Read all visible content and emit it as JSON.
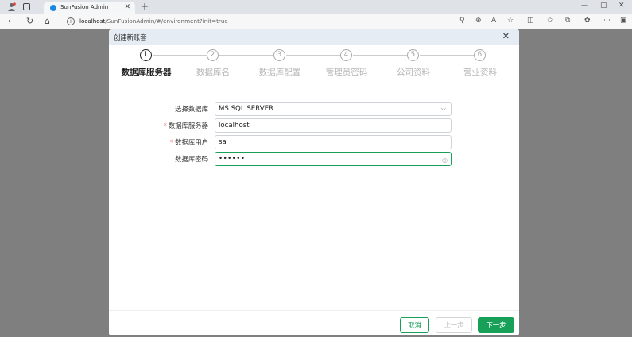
{
  "browser": {
    "tab_title": "SunFusion Admin",
    "url_host": "localhost",
    "url_rest": "/SunFusionAdmin/#/environment?init=true"
  },
  "dialog": {
    "title": "创建新账套",
    "steps": [
      {
        "num": "1",
        "label": "数据库服务器",
        "active": true
      },
      {
        "num": "2",
        "label": "数据库名",
        "active": false
      },
      {
        "num": "3",
        "label": "数据库配置",
        "active": false
      },
      {
        "num": "4",
        "label": "管理员密码",
        "active": false
      },
      {
        "num": "5",
        "label": "公司资料",
        "active": false
      },
      {
        "num": "6",
        "label": "营业资料",
        "active": false
      }
    ],
    "form": {
      "db_type_label": "选择数据库",
      "db_type_value": "MS SQL SERVER",
      "server_label": "数据库服务器",
      "server_value": "localhost",
      "user_label": "数据库用户",
      "user_value": "sa",
      "password_label": "数据库密码",
      "password_value": "••••••"
    },
    "buttons": {
      "cancel": "取消",
      "prev": "上一步",
      "next": "下一步"
    }
  },
  "colors": {
    "accent": "#18a058",
    "required": "#f56c6c",
    "overlay": "#7f7f7f",
    "header": "#e6ecf3"
  }
}
